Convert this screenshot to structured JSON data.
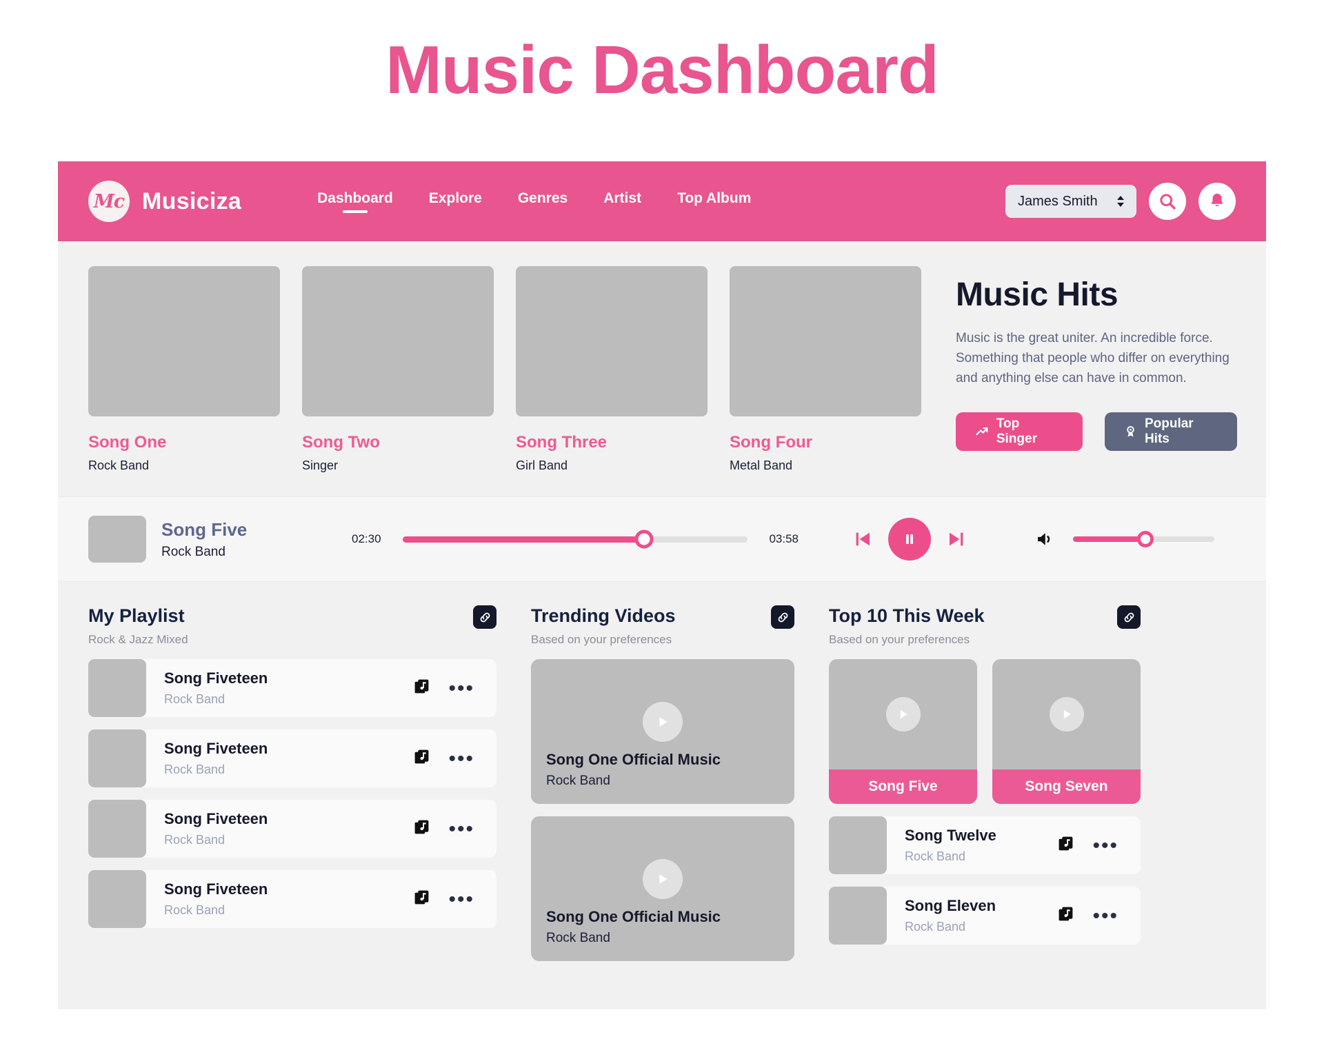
{
  "page_title": "Music Dashboard",
  "colors": {
    "accent_pink": "#e8558f",
    "button_pink": "#ec4e8c",
    "slate": "#5f667f",
    "dark": "#16192c",
    "panel_bg": "#f1f1f1",
    "placeholder_gray": "#bcbcbc"
  },
  "header": {
    "logo_text": "Mc",
    "brand": "Musiciza",
    "nav": [
      {
        "label": "Dashboard",
        "active": true
      },
      {
        "label": "Explore",
        "active": false
      },
      {
        "label": "Genres",
        "active": false
      },
      {
        "label": "Artist",
        "active": false
      },
      {
        "label": "Top Album",
        "active": false
      }
    ],
    "user": "James Smith",
    "search_icon": "search-icon",
    "bell_icon": "notification-bell-icon"
  },
  "hero": {
    "cards": [
      {
        "title": "Song One",
        "artist": "Rock Band"
      },
      {
        "title": "Song Two",
        "artist": "Singer"
      },
      {
        "title": "Song Three",
        "artist": "Girl Band"
      },
      {
        "title": "Song Four",
        "artist": "Metal Band"
      }
    ],
    "title": "Music Hits",
    "description": "Music is the great uniter. An incredible force. Something that people who differ on everything and anything else can have in common.",
    "buttons": [
      {
        "label": "Top Singer",
        "icon": "trending-up-icon",
        "style": "pink"
      },
      {
        "label": "Popular Hits",
        "icon": "award-icon",
        "style": "slate"
      }
    ]
  },
  "player": {
    "song": "Song Five",
    "artist": "Rock Band",
    "current_time": "02:30",
    "total_time": "03:58",
    "progress_percent": 70,
    "volume_percent": 51,
    "prev_icon": "skip-previous-icon",
    "play_icon": "pause-icon",
    "next_icon": "skip-next-icon",
    "volume_icon": "volume-icon"
  },
  "playlist": {
    "title": "My Playlist",
    "subtitle": "Rock & Jazz Mixed",
    "link_icon": "link-icon",
    "rows": [
      {
        "title": "Song Fiveteen",
        "artist": "Rock Band"
      },
      {
        "title": "Song Fiveteen",
        "artist": "Rock Band"
      },
      {
        "title": "Song Fiveteen",
        "artist": "Rock Band"
      },
      {
        "title": "Song Fiveteen",
        "artist": "Rock Band"
      }
    ],
    "row_icon": "add-to-playlist-icon",
    "more_icon": "more-options-icon"
  },
  "trending": {
    "title": "Trending Videos",
    "subtitle": "Based on your preferences",
    "link_icon": "link-icon",
    "videos": [
      {
        "title": "Song One Official Music",
        "artist": "Rock Band",
        "play_icon": "play-icon"
      },
      {
        "title": "Song One Official Music",
        "artist": "Rock Band",
        "play_icon": "play-icon"
      }
    ]
  },
  "top10": {
    "title": "Top 10 This Week",
    "subtitle": "Based on your preferences",
    "link_icon": "link-icon",
    "videos": [
      {
        "label": "Song Five",
        "play_icon": "play-icon"
      },
      {
        "label": "Song Seven",
        "play_icon": "play-icon"
      }
    ],
    "rows": [
      {
        "title": "Song Twelve",
        "artist": "Rock Band"
      },
      {
        "title": "Song Eleven",
        "artist": "Rock Band"
      }
    ],
    "row_icon": "add-to-playlist-icon",
    "more_icon": "more-options-icon"
  }
}
